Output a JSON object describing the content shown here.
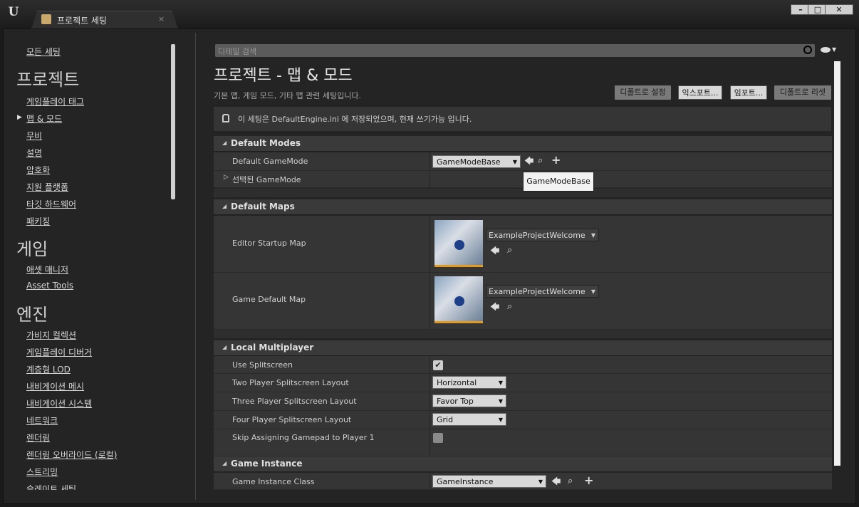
{
  "window": {
    "tab_label": "프로젝트 세팅",
    "tab_close": "×",
    "minimize": "–",
    "maximize": "□",
    "close": "✕",
    "logo_text": "U"
  },
  "sidebar": {
    "all_settings": "모든 세팅",
    "project_heading": "프로젝트",
    "project_items": [
      "게임플레이 태그",
      "맵 & 모드",
      "무비",
      "설명",
      "암호화",
      "지원 플랫폼",
      "타깃 하드웨어",
      "패키징"
    ],
    "selected_item": "맵 & 모드",
    "game_heading": "게임",
    "game_items": [
      "애셋 매니저",
      "Asset Tools"
    ],
    "engine_heading": "엔진",
    "engine_items": [
      "가비지 컬렉션",
      "게임플레이 디버거",
      "계층형 LOD",
      "내비게이션 메시",
      "내비게이션 시스템",
      "네트워크",
      "렌더링",
      "렌더링 오버라이드 (로컬)",
      "스트리밍",
      "슬레이트 세팅"
    ]
  },
  "search": {
    "placeholder": "디테일 검색"
  },
  "header": {
    "title": "프로젝트 - 맵 & 모드",
    "description": "기본 맵, 게임 모드, 기타 맵 관련 세팅입니다.",
    "buttons": {
      "set_default": "디폴트로 설정",
      "export": "익스포트...",
      "import": "임포트...",
      "reset_default": "디폴트로 리셋"
    }
  },
  "notice": {
    "text": "이 세팅은 DefaultEngine.ini 에 저장되었으며, 현재 쓰기가능 입니다."
  },
  "default_modes": {
    "title": "Default Modes",
    "default_gamemode_label": "Default GameMode",
    "default_gamemode_value": "GameModeBase",
    "selected_gamemode_label": "선택된 GameMode",
    "tooltip": "GameModeBase"
  },
  "default_maps": {
    "title": "Default Maps",
    "editor_startup_label": "Editor Startup Map",
    "editor_startup_value": "ExampleProjectWelcome",
    "game_default_label": "Game Default Map",
    "game_default_value": "ExampleProjectWelcome"
  },
  "local_multiplayer": {
    "title": "Local Multiplayer",
    "use_splitscreen_label": "Use Splitscreen",
    "use_splitscreen_checked": true,
    "two_player_label": "Two Player Splitscreen Layout",
    "two_player_value": "Horizontal",
    "three_player_label": "Three Player Splitscreen Layout",
    "three_player_value": "Favor Top",
    "four_player_label": "Four Player Splitscreen Layout",
    "four_player_value": "Grid",
    "skip_gamepad_label": "Skip Assigning Gamepad to Player 1",
    "skip_gamepad_checked": false
  },
  "game_instance": {
    "title": "Game Instance",
    "class_label": "Game Instance Class",
    "class_value": "GameInstance"
  },
  "icons": {
    "check": "✔",
    "back_arrow": "🡄",
    "search": "⌕",
    "plus": "+",
    "caret": "▼",
    "cat_expanded": "◢",
    "row_collapsed": "▷"
  }
}
